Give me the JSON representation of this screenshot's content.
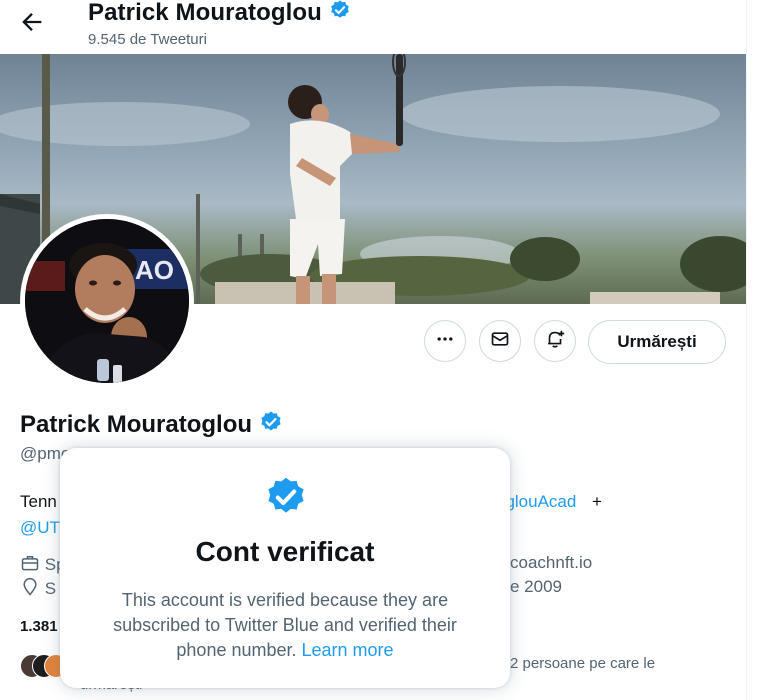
{
  "header": {
    "name": "Patrick Mouratoglou",
    "tweet_count": "9.545 de Tweeturi"
  },
  "profile": {
    "name": "Patrick Mouratoglou",
    "handle_partial": "@pmo",
    "bio_start": "Tenn",
    "bio_link_partial": "oglouAcad",
    "bio_plus": " +",
    "bio_line2_partial": "@UT",
    "meta_category_partial": "Sp",
    "meta_website_partial": "coachnft.io",
    "meta_birth_partial": "S",
    "meta_joined_partial": "e 2009",
    "following_partial": "1.381",
    "followed_by_partial": "2 persoane pe care le",
    "followed_by_line2": "urmărești"
  },
  "actions": {
    "follow_label": "Urmărești"
  },
  "popover": {
    "title": "Cont verificat",
    "body": "This account is verified because they are subscribed to Twitter Blue and verified their phone number.",
    "link": "Learn more"
  },
  "colors": {
    "accent": "#1d9bf0",
    "secondary_text": "#536471",
    "border": "#cfd9de"
  },
  "icons": [
    "back-arrow-icon",
    "verified-badge-icon",
    "more-icon",
    "mail-icon",
    "bell-plus-icon",
    "briefcase-icon",
    "pin-icon",
    "link-icon",
    "calendar-icon"
  ]
}
